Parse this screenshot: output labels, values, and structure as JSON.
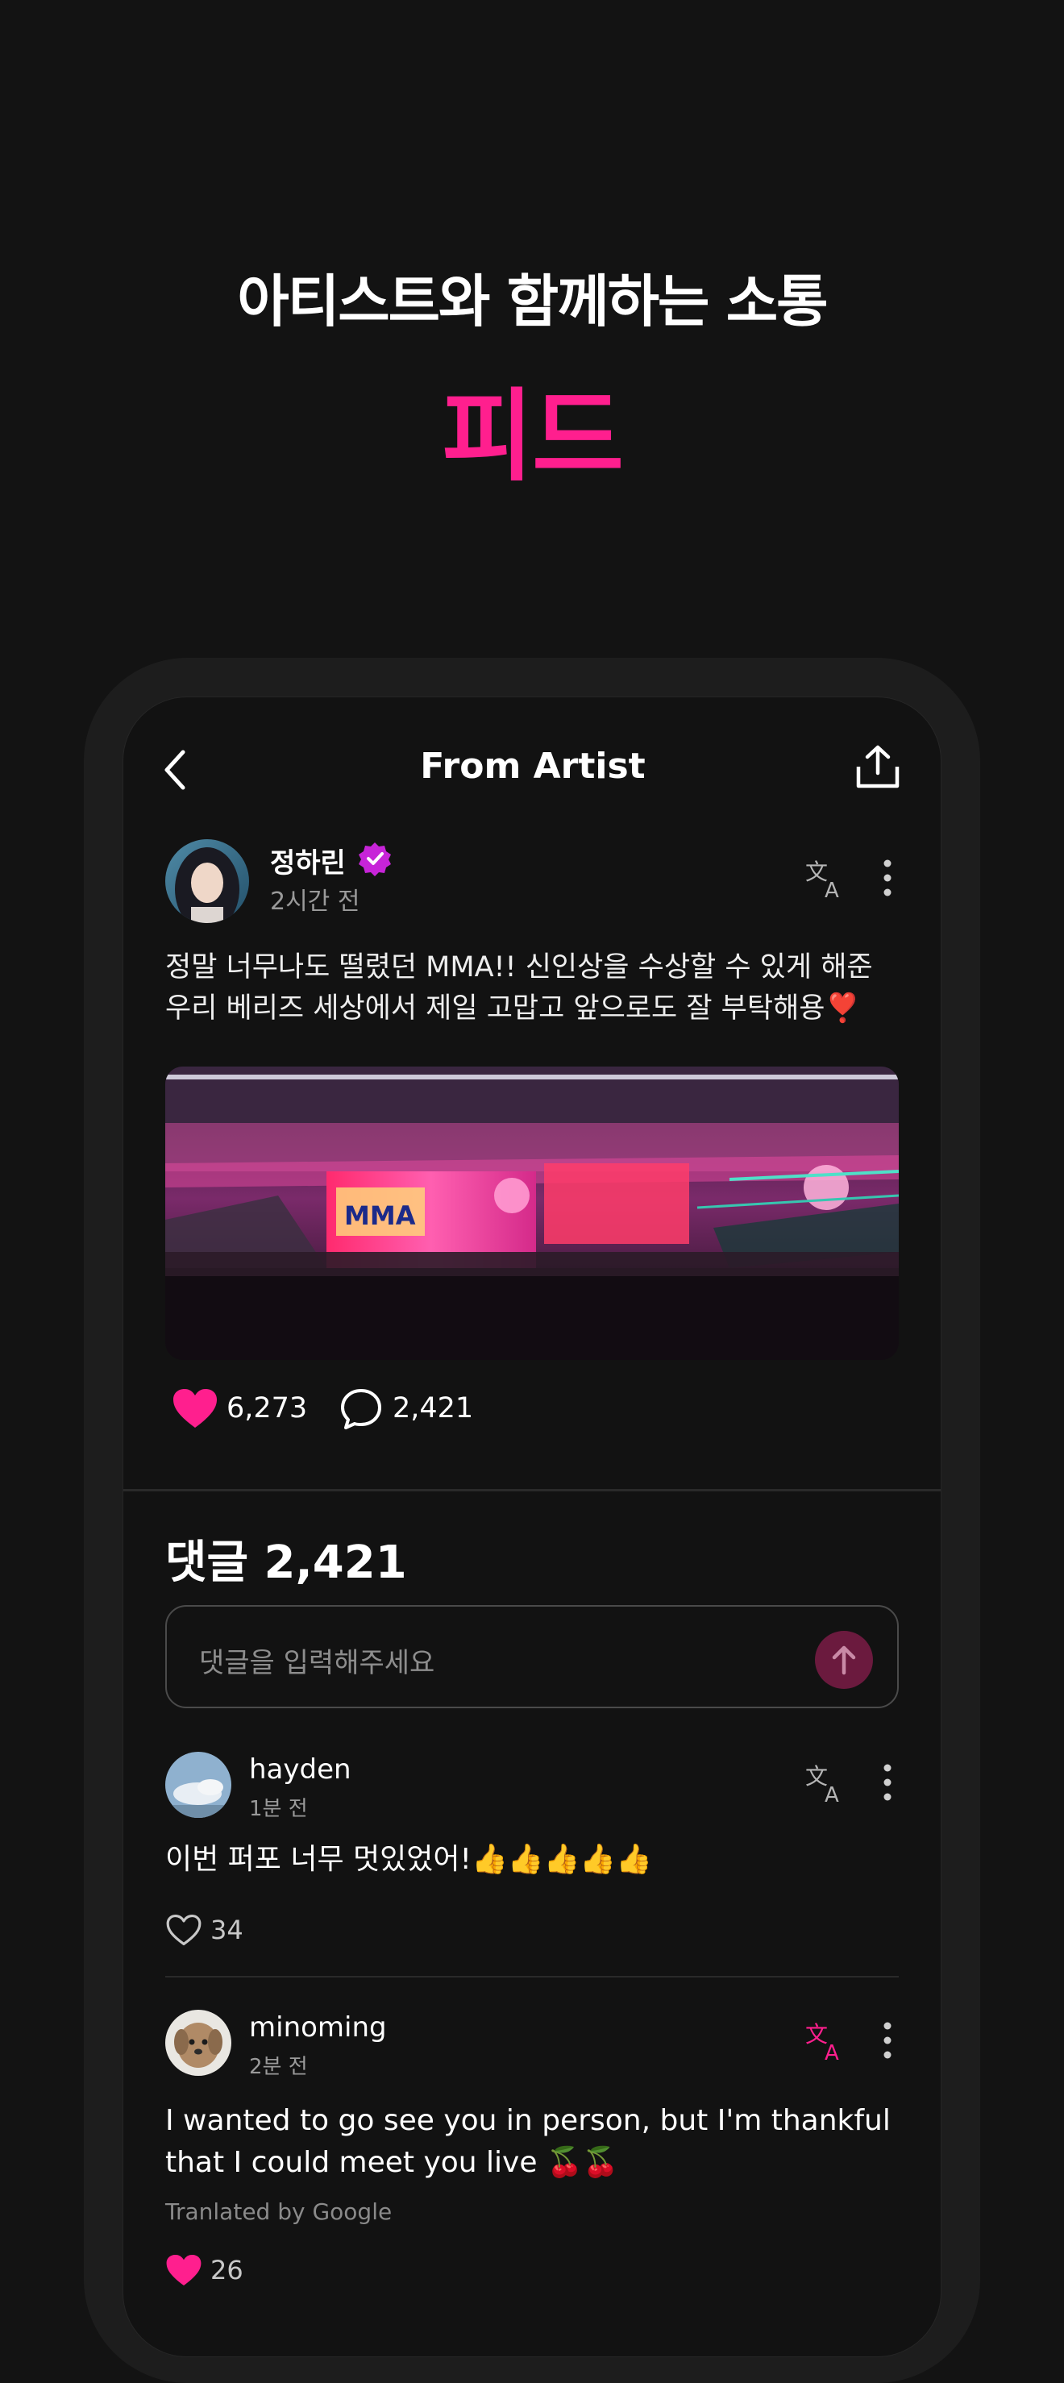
{
  "promo": {
    "title": "아티스트와 함께하는 소통",
    "subtitle": "피드"
  },
  "header": {
    "title": "From Artist",
    "back_icon": "chevron-left-icon",
    "share_icon": "share-upload-icon"
  },
  "post": {
    "author": "정하린",
    "verified_icon": "verified-badge-icon",
    "time": "2시간 전",
    "text_line1": "정말 너무나도 떨렸던 MMA!! 신인상을 수상할 수 있게 해준",
    "text_line2": "우리 베리즈 세상에서 제일 고맙고 앞으로도 잘 부탁해용❣️",
    "likes": "6,273",
    "comments": "2,421",
    "image_sign": "MMA"
  },
  "comments_section": {
    "heading": "댓글 2,421",
    "input_placeholder": "댓글을 입력해주세요"
  },
  "comments": [
    {
      "user": "hayden",
      "time": "1분 전",
      "text": "이번 퍼포 너무 멋있었어!👍👍👍👍👍",
      "likes": "34",
      "liked": false
    },
    {
      "user": "minoming",
      "time": "2분 전",
      "text_line1": "I wanted to go see you in person, but I'm thankful",
      "text_line2": "that I could meet you live 🍒🍒",
      "credit": "Tranlated by Google",
      "likes": "26",
      "liked": true
    }
  ],
  "colors": {
    "accent": "#ff1f8e",
    "background": "#131313",
    "screen": "#121212"
  }
}
